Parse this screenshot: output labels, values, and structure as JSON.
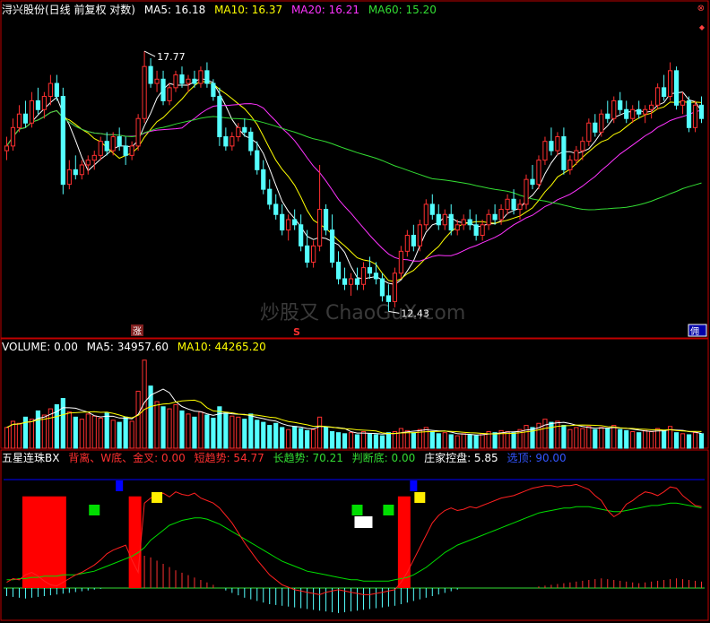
{
  "colors": {
    "background": "#000000",
    "frame": "#c00000",
    "up": "#ff3030",
    "down": "#54ffff",
    "ma5": "#ffffff",
    "ma10": "#ffff00",
    "ma20": "#ff33ff",
    "ma60": "#33dd33",
    "blue": "#0000ff",
    "green": "#00dd00",
    "yellow": "#ffee00",
    "red_bar": "#ff0000"
  },
  "price_panel": {
    "title": "浔兴股份(日线 前复权 对数)",
    "ma5": "MA5: 16.18",
    "ma10": "MA10: 16.37",
    "ma20": "MA20: 16.21",
    "ma60": "MA60: 15.20",
    "high_label": "17.77",
    "low_label": "12.43",
    "marker_zhang": "涨",
    "marker_s": "S",
    "marker_right": "佣",
    "watermark": "炒股又 ChaoGuX.com",
    "ymin": 12.0,
    "ymax": 18.6,
    "candles": [
      [
        15.5,
        15.8,
        15.3,
        15.6
      ],
      [
        15.6,
        16.2,
        15.5,
        16.0
      ],
      [
        16.0,
        16.5,
        15.9,
        16.3
      ],
      [
        16.3,
        16.6,
        16.0,
        16.1
      ],
      [
        16.1,
        16.8,
        16.0,
        16.6
      ],
      [
        16.6,
        16.9,
        16.3,
        16.4
      ],
      [
        16.4,
        16.8,
        16.2,
        16.7
      ],
      [
        16.7,
        17.2,
        16.5,
        17.0
      ],
      [
        17.0,
        17.2,
        16.6,
        16.7
      ],
      [
        16.7,
        16.9,
        14.6,
        14.8
      ],
      [
        14.8,
        15.3,
        14.7,
        15.1
      ],
      [
        15.1,
        15.4,
        14.9,
        15.0
      ],
      [
        15.0,
        15.3,
        14.9,
        15.2
      ],
      [
        15.2,
        15.4,
        15.0,
        15.3
      ],
      [
        15.3,
        15.5,
        15.1,
        15.4
      ],
      [
        15.4,
        15.8,
        15.3,
        15.7
      ],
      [
        15.7,
        15.9,
        15.4,
        15.5
      ],
      [
        15.5,
        15.9,
        15.4,
        15.8
      ],
      [
        15.8,
        16.0,
        15.5,
        15.6
      ],
      [
        15.6,
        15.8,
        15.2,
        15.4
      ],
      [
        15.4,
        15.7,
        15.3,
        15.6
      ],
      [
        15.6,
        16.3,
        15.5,
        16.2
      ],
      [
        16.2,
        17.77,
        16.1,
        17.4
      ],
      [
        17.4,
        17.6,
        16.9,
        17.0
      ],
      [
        17.0,
        17.3,
        16.8,
        17.1
      ],
      [
        17.1,
        17.3,
        16.5,
        16.6
      ],
      [
        16.6,
        17.0,
        16.5,
        16.9
      ],
      [
        16.9,
        17.3,
        16.8,
        17.2
      ],
      [
        17.2,
        17.4,
        16.9,
        17.0
      ],
      [
        17.0,
        17.2,
        16.8,
        17.1
      ],
      [
        17.1,
        17.3,
        16.9,
        17.0
      ],
      [
        17.0,
        17.4,
        16.9,
        17.3
      ],
      [
        17.3,
        17.5,
        16.9,
        17.0
      ],
      [
        17.0,
        17.1,
        16.6,
        16.7
      ],
      [
        16.7,
        16.9,
        15.6,
        15.8
      ],
      [
        15.8,
        16.0,
        15.5,
        15.6
      ],
      [
        15.6,
        15.9,
        15.5,
        15.8
      ],
      [
        15.8,
        16.1,
        15.7,
        16.0
      ],
      [
        16.0,
        16.2,
        15.8,
        15.9
      ],
      [
        15.9,
        16.0,
        15.4,
        15.5
      ],
      [
        15.5,
        15.7,
        15.0,
        15.1
      ],
      [
        15.1,
        15.3,
        14.6,
        14.7
      ],
      [
        14.7,
        14.9,
        14.3,
        14.4
      ],
      [
        14.4,
        14.6,
        14.1,
        14.2
      ],
      [
        14.2,
        14.4,
        13.8,
        13.9
      ],
      [
        13.9,
        14.2,
        13.7,
        14.1
      ],
      [
        14.1,
        14.3,
        13.9,
        14.0
      ],
      [
        14.0,
        14.2,
        13.5,
        13.6
      ],
      [
        13.6,
        13.9,
        13.2,
        13.3
      ],
      [
        13.3,
        13.7,
        13.2,
        13.6
      ],
      [
        13.6,
        15.2,
        13.5,
        14.3
      ],
      [
        14.3,
        14.4,
        13.8,
        13.9
      ],
      [
        13.9,
        14.2,
        13.2,
        13.3
      ],
      [
        13.3,
        13.5,
        12.9,
        13.0
      ],
      [
        13.0,
        13.2,
        12.8,
        12.9
      ],
      [
        12.9,
        13.1,
        12.7,
        13.0
      ],
      [
        13.0,
        13.2,
        12.8,
        12.9
      ],
      [
        12.9,
        13.3,
        12.8,
        13.2
      ],
      [
        13.2,
        13.4,
        13.0,
        13.1
      ],
      [
        13.1,
        13.3,
        12.9,
        13.0
      ],
      [
        13.0,
        13.1,
        12.6,
        12.7
      ],
      [
        12.7,
        12.9,
        12.43,
        12.6
      ],
      [
        12.6,
        13.2,
        12.5,
        13.1
      ],
      [
        13.1,
        13.6,
        13.0,
        13.5
      ],
      [
        13.5,
        13.9,
        13.4,
        13.8
      ],
      [
        13.8,
        14.0,
        13.5,
        13.6
      ],
      [
        13.6,
        14.1,
        13.5,
        14.0
      ],
      [
        14.0,
        14.5,
        13.9,
        14.4
      ],
      [
        14.4,
        14.6,
        14.1,
        14.2
      ],
      [
        14.2,
        14.4,
        13.9,
        14.0
      ],
      [
        14.0,
        14.3,
        13.9,
        14.2
      ],
      [
        14.2,
        14.4,
        13.8,
        13.9
      ],
      [
        13.9,
        14.1,
        13.8,
        14.0
      ],
      [
        14.0,
        14.2,
        13.9,
        14.1
      ],
      [
        14.1,
        14.3,
        13.9,
        14.0
      ],
      [
        14.0,
        14.2,
        13.7,
        13.8
      ],
      [
        13.8,
        14.1,
        13.7,
        14.0
      ],
      [
        14.0,
        14.3,
        13.9,
        14.2
      ],
      [
        14.2,
        14.4,
        14.0,
        14.1
      ],
      [
        14.1,
        14.4,
        14.0,
        14.3
      ],
      [
        14.3,
        14.6,
        14.2,
        14.5
      ],
      [
        14.5,
        14.7,
        14.2,
        14.3
      ],
      [
        14.3,
        14.5,
        14.1,
        14.4
      ],
      [
        14.4,
        15.0,
        14.3,
        14.9
      ],
      [
        14.9,
        15.2,
        14.7,
        14.8
      ],
      [
        14.8,
        15.4,
        14.7,
        15.3
      ],
      [
        15.3,
        15.8,
        15.2,
        15.7
      ],
      [
        15.7,
        16.0,
        15.4,
        15.5
      ],
      [
        15.5,
        15.9,
        15.4,
        15.8
      ],
      [
        15.8,
        16.0,
        15.0,
        15.1
      ],
      [
        15.1,
        15.4,
        15.0,
        15.3
      ],
      [
        15.3,
        15.6,
        15.2,
        15.5
      ],
      [
        15.5,
        15.8,
        15.3,
        15.7
      ],
      [
        15.7,
        16.2,
        15.6,
        16.1
      ],
      [
        16.1,
        16.3,
        15.8,
        15.9
      ],
      [
        15.9,
        16.4,
        15.8,
        16.3
      ],
      [
        16.3,
        16.6,
        16.1,
        16.2
      ],
      [
        16.2,
        16.7,
        16.1,
        16.6
      ],
      [
        16.6,
        16.8,
        16.3,
        16.4
      ],
      [
        16.4,
        16.6,
        16.1,
        16.2
      ],
      [
        16.2,
        16.5,
        16.1,
        16.4
      ],
      [
        16.4,
        16.6,
        16.2,
        16.3
      ],
      [
        16.3,
        16.5,
        16.1,
        16.4
      ],
      [
        16.4,
        16.6,
        16.2,
        16.5
      ],
      [
        16.5,
        17.0,
        16.4,
        16.9
      ],
      [
        16.9,
        17.2,
        16.6,
        16.7
      ],
      [
        16.7,
        17.5,
        16.6,
        17.3
      ],
      [
        17.3,
        17.4,
        16.4,
        16.5
      ],
      [
        16.5,
        16.8,
        16.3,
        16.6
      ],
      [
        16.6,
        16.7,
        15.9,
        16.0
      ],
      [
        16.0,
        16.6,
        15.9,
        16.5
      ],
      [
        16.5,
        16.7,
        16.1,
        16.2
      ]
    ]
  },
  "volume_panel": {
    "label": "VOLUME: 0.00",
    "ma5": "MA5: 34957.60",
    "ma10": "MA10: 44265.20",
    "vmax": 90000,
    "values": [
      20000,
      26000,
      24000,
      30000,
      28000,
      36000,
      32000,
      38000,
      42000,
      48000,
      35000,
      30000,
      28000,
      33000,
      31000,
      29000,
      34000,
      27000,
      25000,
      30000,
      26000,
      55000,
      85000,
      60000,
      45000,
      40000,
      38000,
      42000,
      36000,
      33000,
      30000,
      35000,
      32000,
      29000,
      40000,
      34000,
      31000,
      30000,
      28000,
      33000,
      27000,
      25000,
      22000,
      24000,
      20000,
      18000,
      21000,
      19000,
      17000,
      18000,
      30000,
      20000,
      16000,
      15000,
      14000,
      15000,
      13000,
      16000,
      14000,
      13000,
      12000,
      15000,
      16000,
      19000,
      17000,
      15000,
      18000,
      20000,
      16000,
      14000,
      15000,
      13000,
      12000,
      14000,
      13000,
      12000,
      14000,
      16000,
      15000,
      17000,
      16000,
      15000,
      18000,
      22000,
      20000,
      24000,
      28000,
      25000,
      26000,
      22000,
      18000,
      20000,
      19000,
      21000,
      18000,
      20000,
      19000,
      22000,
      18000,
      17000,
      16000,
      15000,
      17000,
      16000,
      19000,
      17000,
      21000,
      15000,
      14000,
      13000,
      15000,
      14000
    ]
  },
  "indicator_panel": {
    "name": "五星连珠BX",
    "beili": "背离、W底、金叉: 0.00",
    "duan": "短趋势: 54.77",
    "chang": "长趋势: 70.21",
    "panduan": "判断底: 0.00",
    "zhuangjia": "庄家控盘: 5.85",
    "xuandian": "选顶: 90.00",
    "short_trend": [
      22,
      25,
      24,
      28,
      30,
      27,
      23,
      20,
      19,
      22,
      25,
      28,
      30,
      33,
      36,
      40,
      45,
      48,
      50,
      52,
      40,
      30,
      86,
      90,
      92,
      94,
      91,
      95,
      93,
      92,
      94,
      90,
      88,
      86,
      82,
      76,
      70,
      62,
      54,
      47,
      40,
      34,
      28,
      24,
      20,
      18,
      16,
      15,
      14,
      13,
      12,
      14,
      15,
      16,
      15,
      14,
      13,
      12,
      12,
      13,
      14,
      15,
      16,
      22,
      30,
      40,
      50,
      60,
      70,
      76,
      80,
      82,
      80,
      81,
      83,
      82,
      84,
      86,
      88,
      90,
      91,
      92,
      94,
      96,
      98,
      99,
      100,
      100,
      99,
      100,
      100,
      101,
      99,
      97,
      92,
      88,
      80,
      75,
      78,
      85,
      88,
      92,
      95,
      94,
      92,
      95,
      99,
      98,
      92,
      88,
      84,
      83
    ],
    "long_trend": [
      24,
      24,
      25,
      25,
      26,
      26,
      27,
      27,
      27,
      28,
      28,
      28,
      29,
      30,
      31,
      33,
      35,
      37,
      39,
      41,
      43,
      46,
      50,
      56,
      60,
      64,
      68,
      70,
      72,
      73,
      74,
      74,
      73,
      71,
      69,
      66,
      63,
      60,
      57,
      54,
      51,
      48,
      45,
      42,
      39,
      37,
      35,
      33,
      31,
      30,
      29,
      28,
      27,
      26,
      25,
      24,
      24,
      23,
      23,
      23,
      23,
      23,
      24,
      25,
      26,
      28,
      31,
      34,
      38,
      42,
      46,
      49,
      52,
      54,
      56,
      58,
      60,
      62,
      64,
      66,
      68,
      70,
      72,
      74,
      76,
      78,
      79,
      80,
      81,
      82,
      82,
      83,
      83,
      83,
      82,
      81,
      80,
      79,
      79,
      80,
      81,
      82,
      83,
      84,
      84,
      85,
      86,
      86,
      85,
      84,
      83,
      82
    ],
    "sticks": [
      -10,
      -11,
      -12,
      -13,
      -12,
      -11,
      -10,
      -9,
      -8,
      -7,
      -6,
      -5,
      -4,
      -3,
      -2,
      -1,
      0,
      0,
      0,
      0,
      0,
      30,
      40,
      38,
      34,
      30,
      26,
      22,
      19,
      16,
      13,
      10,
      7,
      4,
      0,
      -3,
      -6,
      -9,
      -12,
      -14,
      -16,
      -18,
      -20,
      -21,
      -22,
      -23,
      -24,
      -25,
      -26,
      -27,
      -28,
      -29,
      -30,
      -31,
      -30,
      -29,
      -28,
      -27,
      -26,
      -25,
      -24,
      -23,
      -22,
      -20,
      -18,
      -16,
      -14,
      -12,
      -10,
      -8,
      -6,
      -4,
      -2,
      0,
      0,
      0,
      0,
      0,
      0,
      0,
      0,
      0,
      0,
      0,
      0,
      2,
      3,
      4,
      5,
      6,
      7,
      8,
      9,
      10,
      11,
      12,
      11,
      10,
      9,
      8,
      7,
      6,
      7,
      8,
      9,
      10,
      11,
      12,
      11,
      10,
      9,
      8
    ],
    "red_bars": [
      [
        3,
        10,
        95
      ],
      [
        20,
        22,
        95
      ],
      [
        63,
        65,
        95
      ]
    ],
    "blue_squares": [
      18,
      65
    ],
    "green_squares": [
      14,
      56,
      61
    ],
    "yellow_squares": [
      24,
      66
    ],
    "white_rects": [
      57
    ]
  }
}
